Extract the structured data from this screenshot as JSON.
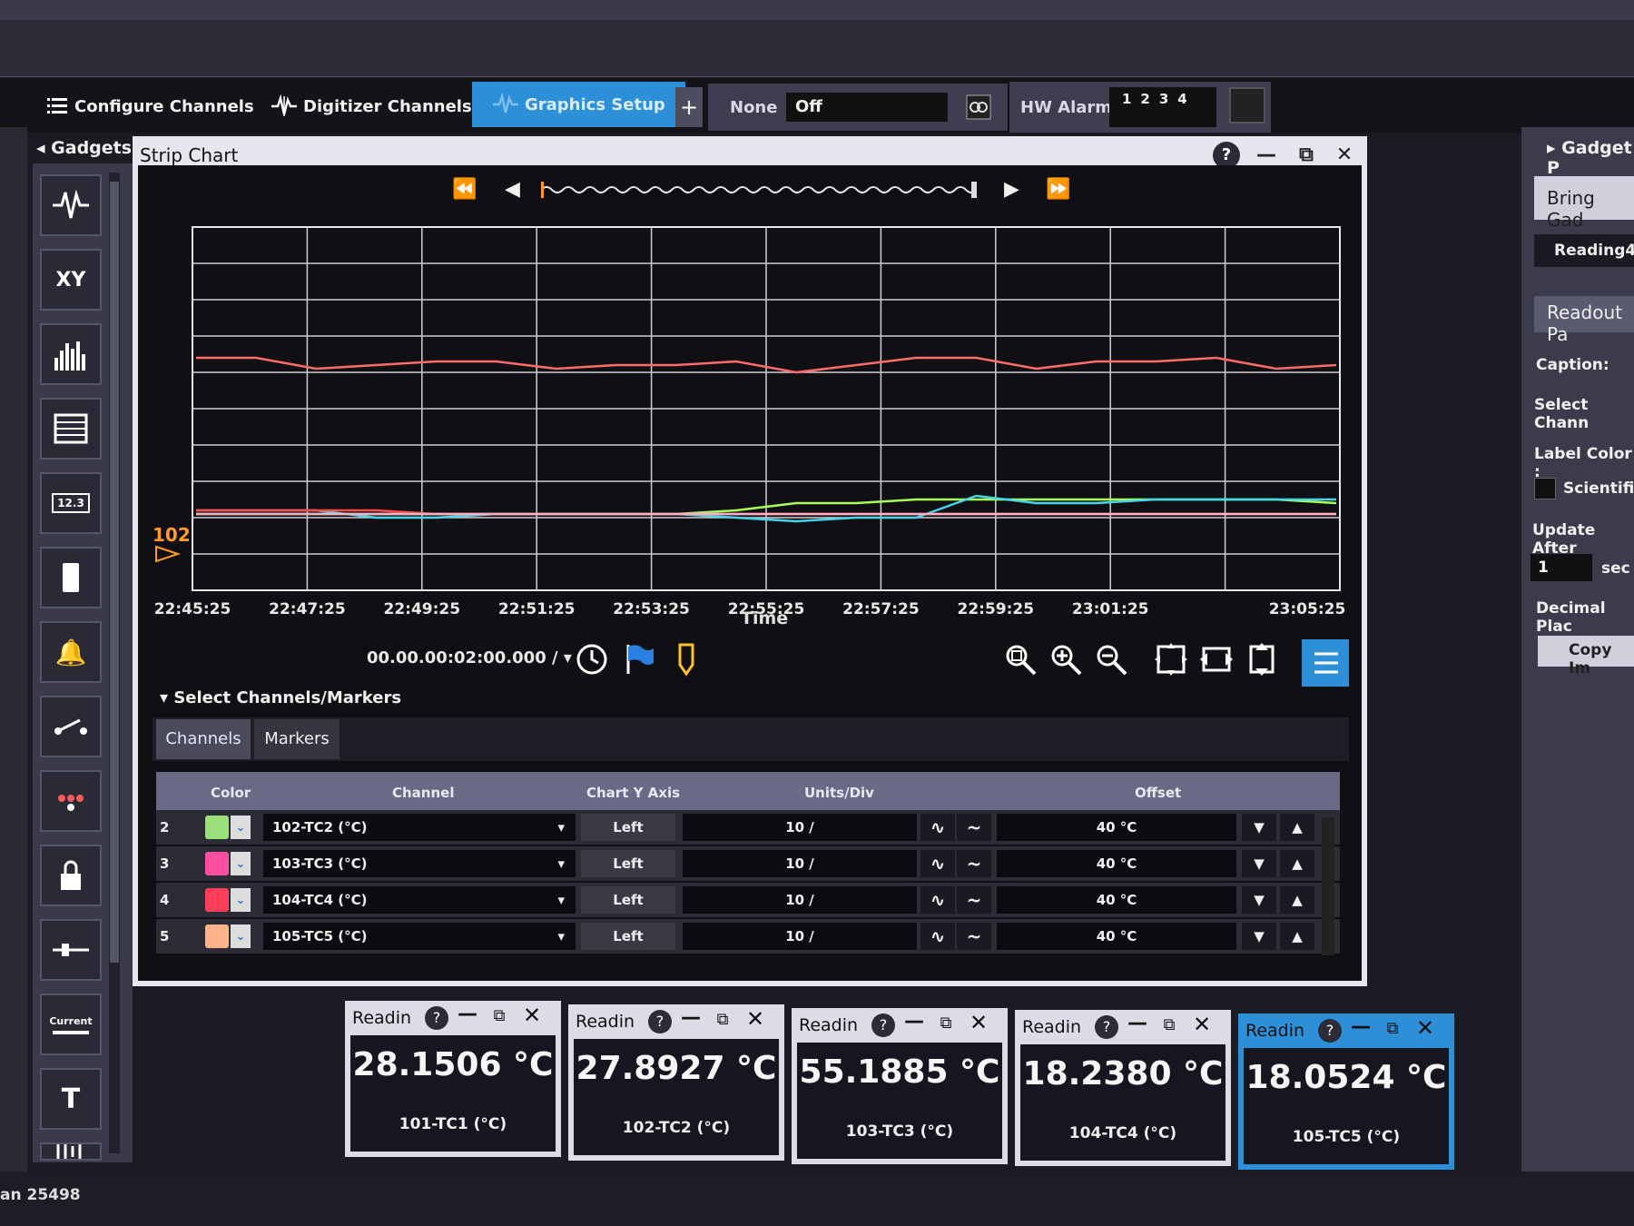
{
  "tabs": {
    "configure": "Configure Channels",
    "digitizer": "Digitizer Channels",
    "graphics": "Graphics Setup",
    "plus": "+"
  },
  "toolbar": {
    "none_label": "None",
    "off_value": "Off",
    "hw_alarm_label": "HW Alarm",
    "hw_alarm_numbers": "1234"
  },
  "gadgets": {
    "header": "Gadgets",
    "items": [
      "strip-chart",
      "XY",
      "histogram",
      "table",
      "12.3",
      "bar",
      "alarm-bell",
      "switch",
      "leds",
      "lock",
      "slider",
      "Current",
      "T",
      "audio"
    ]
  },
  "strip_chart": {
    "title": "Strip Chart",
    "time_span": "00.00.00:02:00.000 /",
    "x_title": "Time",
    "marker_label": "102",
    "select_header": "Select Channels/Markers",
    "subtabs": [
      "Channels",
      "Markers"
    ],
    "table_headers": [
      "Color",
      "Channel",
      "Chart Y Axis",
      "Units/Div",
      "Offset"
    ],
    "rows": [
      {
        "num": "2",
        "color": "#9be07a",
        "channel": "102-TC2 (°C)",
        "axis": "Left",
        "units": "10 /",
        "offset": "40 °C"
      },
      {
        "num": "3",
        "color": "#ff4fa3",
        "channel": "103-TC3 (°C)",
        "axis": "Left",
        "units": "10 /",
        "offset": "40 °C"
      },
      {
        "num": "4",
        "color": "#ff3f5a",
        "channel": "104-TC4 (°C)",
        "axis": "Left",
        "units": "10 /",
        "offset": "40 °C"
      },
      {
        "num": "5",
        "color": "#ffb38a",
        "channel": "105-TC5 (°C)",
        "axis": "Left",
        "units": "10 /",
        "offset": "40 °C"
      }
    ]
  },
  "chart_data": {
    "type": "line",
    "xlabel": "Time",
    "x": [
      "22:45:25",
      "22:47:25",
      "22:49:25",
      "22:51:25",
      "22:53:25",
      "22:55:25",
      "22:57:25",
      "22:59:25",
      "23:01:25",
      "23:05:25"
    ],
    "y_divisions": 10,
    "x_divisions": 10,
    "grid": true,
    "series": [
      {
        "color": "#ff6a6a",
        "values": [
          64,
          64,
          61,
          62,
          63,
          63,
          61,
          62,
          62,
          63,
          60,
          62,
          64,
          64,
          61,
          63,
          63,
          64,
          61,
          62
        ]
      },
      {
        "color": "#a8ff5a",
        "values": [
          21,
          21,
          21,
          21,
          21,
          21,
          21,
          21,
          21,
          22,
          24,
          24,
          25,
          25,
          25,
          25,
          25,
          25,
          25,
          24
        ]
      },
      {
        "color": "#46d4e8",
        "values": [
          22,
          22,
          22,
          20,
          20,
          21,
          21,
          21,
          21,
          20,
          19,
          20,
          20,
          26,
          24,
          24,
          25,
          25,
          25,
          25
        ]
      },
      {
        "color": "#ff4a4a",
        "values": [
          22,
          22,
          22,
          22,
          21,
          21,
          21,
          21,
          21,
          21,
          21,
          21,
          21,
          21,
          21,
          21,
          21,
          21,
          21,
          21
        ]
      },
      {
        "color": "#ffb0c8",
        "values": [
          21,
          21,
          21,
          21,
          21,
          21,
          21,
          21,
          21,
          21,
          21,
          21,
          21,
          21,
          21,
          21,
          21,
          21,
          21,
          21
        ]
      }
    ]
  },
  "gadget_panel": {
    "header": "Gadget P",
    "bring": "Bring Gad",
    "reading": "Reading4",
    "readout_header": "Readout Pa",
    "caption": "Caption:",
    "select_channel": "Select Chann",
    "label_color": "Label Color :",
    "scientific": "Scientific",
    "update_after": "Update After",
    "update_value": "1",
    "update_unit": "sec",
    "decimal": "Decimal Plac",
    "copy": "Copy Im"
  },
  "readings": [
    {
      "caption": "Readin",
      "value": "28.1506 °C",
      "channel": "101-TC1 (°C)"
    },
    {
      "caption": "Readin",
      "value": "27.8927 °C",
      "channel": "102-TC2 (°C)"
    },
    {
      "caption": "Readin",
      "value": "55.1885 °C",
      "channel": "103-TC3 (°C)"
    },
    {
      "caption": "Readin",
      "value": "18.2380 °C",
      "channel": "104-TC4 (°C)"
    },
    {
      "caption": "Readin",
      "value": "18.0524 °C",
      "channel": "105-TC5 (°C)"
    }
  ],
  "status": {
    "left": "an 25498"
  }
}
